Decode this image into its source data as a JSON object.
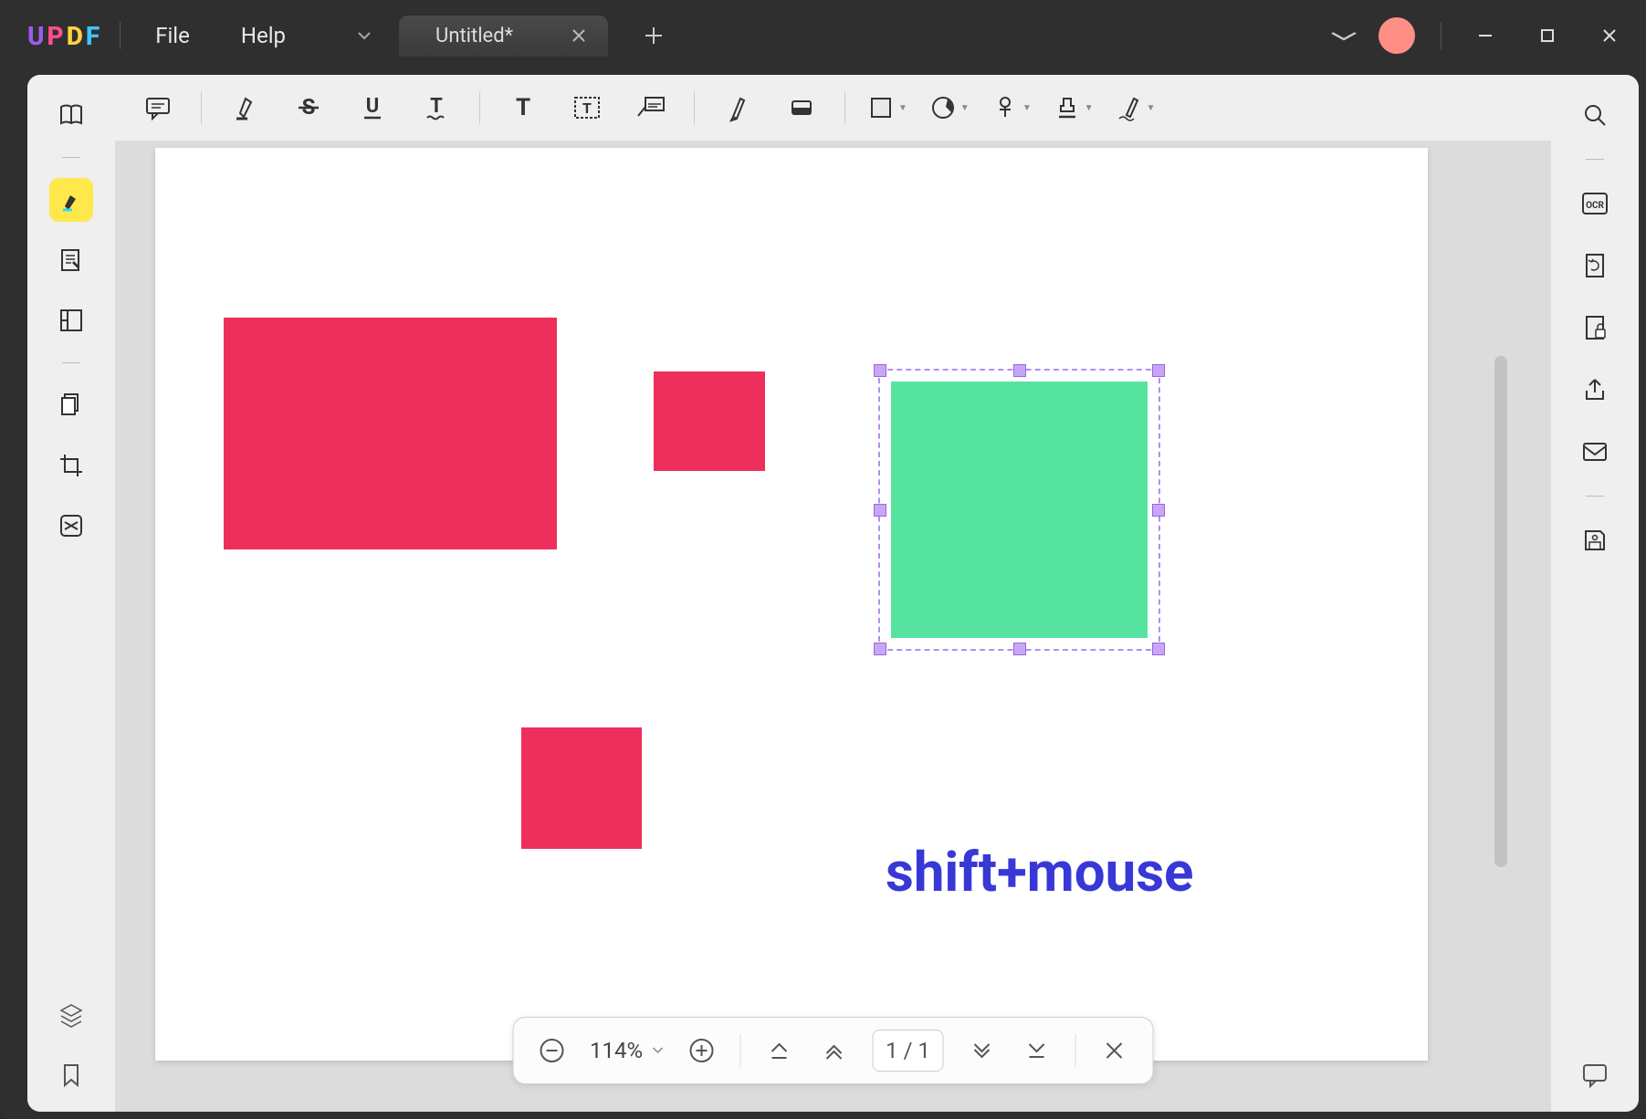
{
  "app": {
    "logo_chars": [
      "U",
      "P",
      "D",
      "F"
    ]
  },
  "menu": {
    "file": "File",
    "help": "Help"
  },
  "tabs": {
    "current_title": "Untitled*"
  },
  "canvas": {
    "text_annotation": "shift+mouse",
    "colors": {
      "pink": "#ee2e5c",
      "green": "#56e3a0",
      "selection": "#b48df5",
      "text": "#3838d6"
    }
  },
  "bottombar": {
    "zoom_label": "114%",
    "page_current": "1",
    "page_sep": "/",
    "page_total": "1"
  },
  "right_rail": {
    "ocr_label": "OCR"
  }
}
